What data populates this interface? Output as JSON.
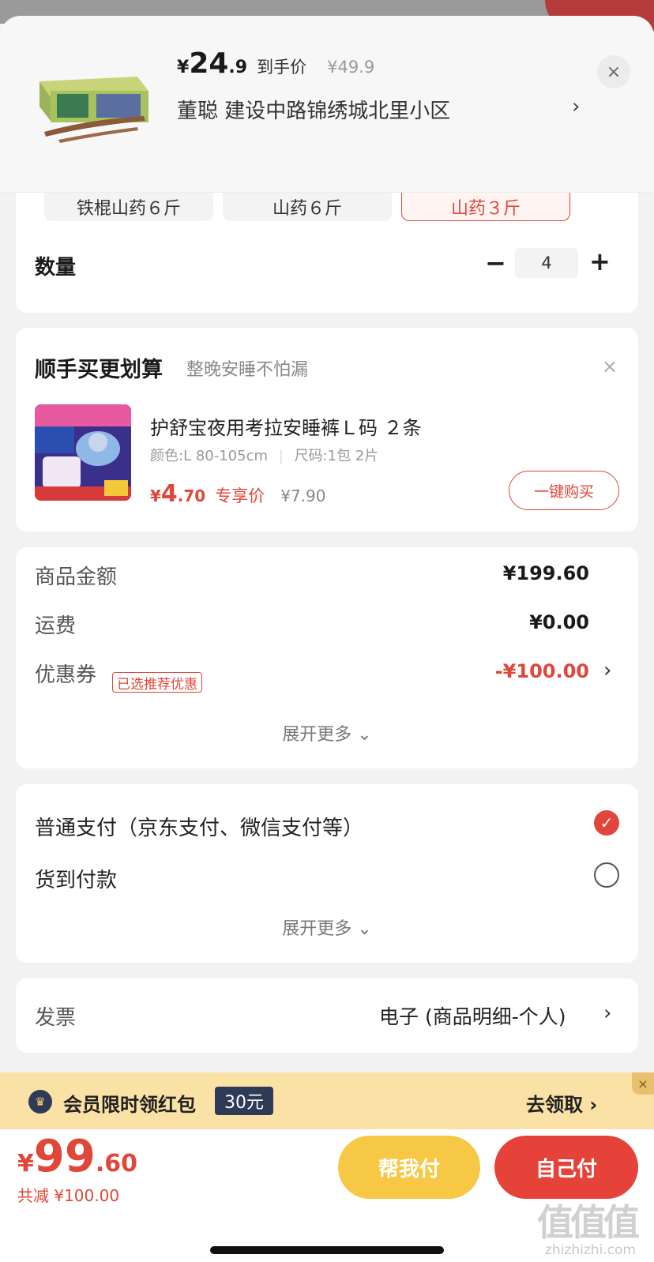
{
  "header": {
    "price_symbol": "¥",
    "price_int": "24",
    "price_dec": ".9",
    "price_tag": "到手价",
    "original_price": "¥49.9",
    "address": "董聪  建设中路锦绣城北里小区",
    "chevron": "›",
    "close": "×"
  },
  "spec": {
    "options": [
      "铁棍山药６斤",
      "山药６斤",
      "山药３斤"
    ],
    "selected_index": 2,
    "quantity_label": "数量",
    "minus": "−",
    "quantity_value": "4",
    "plus": "+"
  },
  "addon": {
    "title": "顺手买更划算",
    "subtitle": "整晚安睡不怕漏",
    "close": "×",
    "product_name": "护舒宝夜用考拉安睡裤Ｌ码 ２条",
    "spec_color": "颜色:L 80-105cm",
    "spec_size": "尺码:1包 2片",
    "price_symbol": "¥",
    "price_int": "4",
    "price_dec": ".70",
    "price_tag": "专享价",
    "original_price": "¥7.90",
    "buy_button": "一键购买"
  },
  "totals": {
    "goods_label": "商品金额",
    "goods_value": "¥199.60",
    "shipping_label": "运费",
    "shipping_value": "¥0.00",
    "coupon_label": "优惠券",
    "coupon_badge": "已选推荐优惠",
    "coupon_value": "-¥100.00",
    "chevron": "›",
    "expand": "展开更多 ⌄"
  },
  "payment": {
    "normal": "普通支付（京东支付、微信支付等）",
    "cod": "货到付款",
    "expand": "展开更多 ⌄",
    "check": "✓"
  },
  "invoice": {
    "label": "发票",
    "value": "电子 (商品明细-个人)",
    "chevron": "›"
  },
  "promo": {
    "icon": "♛",
    "text": "会员限时领红包",
    "badge": "30元",
    "link": "去领取  ›",
    "close": "×"
  },
  "bottom": {
    "symbol": "¥",
    "total_int": "99",
    "total_dec": ".60",
    "saved": "共减 ¥100.00",
    "help_pay": "帮我付",
    "self_pay": "自己付"
  },
  "watermark": {
    "big": "值值值",
    "small": "zhizhizhi.com"
  },
  "colors": {
    "accent_red": "#e0463a",
    "accent_yellow": "#f7c846",
    "promo_bg": "#fae1a6",
    "navy": "#2f3a57"
  }
}
